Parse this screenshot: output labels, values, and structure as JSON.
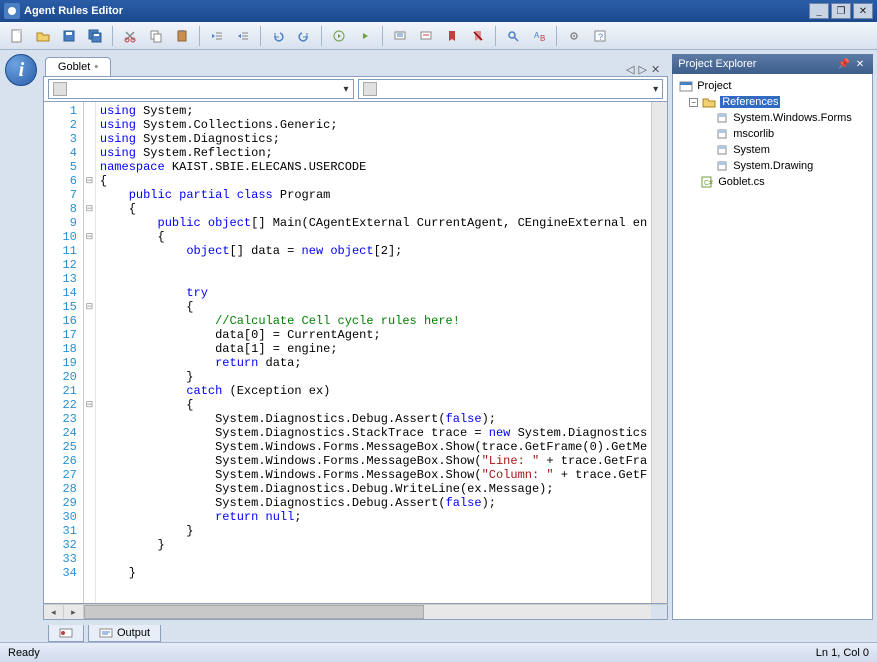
{
  "window": {
    "title": "Agent Rules Editor"
  },
  "tab": {
    "name": "Goblet"
  },
  "combos": {
    "left": "",
    "right": ""
  },
  "code": {
    "lines": [
      {
        "n": 1,
        "fold": "",
        "t": [
          {
            "c": "kw",
            "s": "using"
          },
          {
            "c": "",
            "s": " System;"
          }
        ]
      },
      {
        "n": 2,
        "fold": "",
        "t": [
          {
            "c": "kw",
            "s": "using"
          },
          {
            "c": "",
            "s": " System.Collections.Generic;"
          }
        ]
      },
      {
        "n": 3,
        "fold": "",
        "t": [
          {
            "c": "kw",
            "s": "using"
          },
          {
            "c": "",
            "s": " System.Diagnostics;"
          }
        ]
      },
      {
        "n": 4,
        "fold": "",
        "t": [
          {
            "c": "kw",
            "s": "using"
          },
          {
            "c": "",
            "s": " System.Reflection;"
          }
        ]
      },
      {
        "n": 5,
        "fold": "",
        "t": [
          {
            "c": "kw",
            "s": "namespace"
          },
          {
            "c": "",
            "s": " KAIST.SBIE.ELECANS.USERCODE"
          }
        ]
      },
      {
        "n": 6,
        "fold": "⊟",
        "t": [
          {
            "c": "",
            "s": "{"
          }
        ]
      },
      {
        "n": 7,
        "fold": "",
        "t": [
          {
            "c": "",
            "s": "    "
          },
          {
            "c": "kw",
            "s": "public partial class"
          },
          {
            "c": "",
            "s": " Program"
          }
        ]
      },
      {
        "n": 8,
        "fold": "⊟",
        "t": [
          {
            "c": "",
            "s": "    {"
          }
        ]
      },
      {
        "n": 9,
        "fold": "",
        "t": [
          {
            "c": "",
            "s": "        "
          },
          {
            "c": "kw",
            "s": "public object"
          },
          {
            "c": "",
            "s": "[] Main(CAgentExternal CurrentAgent, CEngineExternal en"
          }
        ]
      },
      {
        "n": 10,
        "fold": "⊟",
        "t": [
          {
            "c": "",
            "s": "        {"
          }
        ]
      },
      {
        "n": 11,
        "fold": "",
        "t": [
          {
            "c": "",
            "s": "            "
          },
          {
            "c": "kw",
            "s": "object"
          },
          {
            "c": "",
            "s": "[] data = "
          },
          {
            "c": "kw",
            "s": "new object"
          },
          {
            "c": "",
            "s": "["
          },
          {
            "c": "num",
            "s": "2"
          },
          {
            "c": "",
            "s": "];"
          }
        ]
      },
      {
        "n": 12,
        "fold": "",
        "t": [
          {
            "c": "",
            "s": ""
          }
        ]
      },
      {
        "n": 13,
        "fold": "",
        "t": [
          {
            "c": "",
            "s": ""
          }
        ]
      },
      {
        "n": 14,
        "fold": "",
        "t": [
          {
            "c": "",
            "s": "            "
          },
          {
            "c": "kw",
            "s": "try"
          }
        ]
      },
      {
        "n": 15,
        "fold": "⊟",
        "t": [
          {
            "c": "",
            "s": "            {"
          }
        ]
      },
      {
        "n": 16,
        "fold": "",
        "t": [
          {
            "c": "",
            "s": "                "
          },
          {
            "c": "cm",
            "s": "//Calculate Cell cycle rules here!"
          }
        ]
      },
      {
        "n": 17,
        "fold": "",
        "t": [
          {
            "c": "",
            "s": "                data["
          },
          {
            "c": "num",
            "s": "0"
          },
          {
            "c": "",
            "s": "] = CurrentAgent;"
          }
        ]
      },
      {
        "n": 18,
        "fold": "",
        "t": [
          {
            "c": "",
            "s": "                data["
          },
          {
            "c": "num",
            "s": "1"
          },
          {
            "c": "",
            "s": "] = engine;"
          }
        ]
      },
      {
        "n": 19,
        "fold": "",
        "t": [
          {
            "c": "",
            "s": "                "
          },
          {
            "c": "kw",
            "s": "return"
          },
          {
            "c": "",
            "s": " data;"
          }
        ]
      },
      {
        "n": 20,
        "fold": "",
        "t": [
          {
            "c": "",
            "s": "            }"
          }
        ]
      },
      {
        "n": 21,
        "fold": "",
        "t": [
          {
            "c": "",
            "s": "            "
          },
          {
            "c": "kw",
            "s": "catch"
          },
          {
            "c": "",
            "s": " (Exception ex)"
          }
        ]
      },
      {
        "n": 22,
        "fold": "⊟",
        "t": [
          {
            "c": "",
            "s": "            {"
          }
        ]
      },
      {
        "n": 23,
        "fold": "",
        "t": [
          {
            "c": "",
            "s": "                System.Diagnostics.Debug.Assert("
          },
          {
            "c": "kw",
            "s": "false"
          },
          {
            "c": "",
            "s": ");"
          }
        ]
      },
      {
        "n": 24,
        "fold": "",
        "t": [
          {
            "c": "",
            "s": "                System.Diagnostics.StackTrace trace = "
          },
          {
            "c": "kw",
            "s": "new"
          },
          {
            "c": "",
            "s": " System.Diagnostics"
          }
        ]
      },
      {
        "n": 25,
        "fold": "",
        "t": [
          {
            "c": "",
            "s": "                System.Windows.Forms.MessageBox.Show(trace.GetFrame("
          },
          {
            "c": "num",
            "s": "0"
          },
          {
            "c": "",
            "s": ").GetMe"
          }
        ]
      },
      {
        "n": 26,
        "fold": "",
        "t": [
          {
            "c": "",
            "s": "                System.Windows.Forms.MessageBox.Show("
          },
          {
            "c": "str",
            "s": "\"Line: \""
          },
          {
            "c": "",
            "s": " + trace.GetFra"
          }
        ]
      },
      {
        "n": 27,
        "fold": "",
        "t": [
          {
            "c": "",
            "s": "                System.Windows.Forms.MessageBox.Show("
          },
          {
            "c": "str",
            "s": "\"Column: \""
          },
          {
            "c": "",
            "s": " + trace.GetF"
          }
        ]
      },
      {
        "n": 28,
        "fold": "",
        "t": [
          {
            "c": "",
            "s": "                System.Diagnostics.Debug.WriteLine(ex.Message);"
          }
        ]
      },
      {
        "n": 29,
        "fold": "",
        "t": [
          {
            "c": "",
            "s": "                System.Diagnostics.Debug.Assert("
          },
          {
            "c": "kw",
            "s": "false"
          },
          {
            "c": "",
            "s": ");"
          }
        ]
      },
      {
        "n": 30,
        "fold": "",
        "t": [
          {
            "c": "",
            "s": "                "
          },
          {
            "c": "kw",
            "s": "return null"
          },
          {
            "c": "",
            "s": ";"
          }
        ]
      },
      {
        "n": 31,
        "fold": "",
        "t": [
          {
            "c": "",
            "s": "            }"
          }
        ]
      },
      {
        "n": 32,
        "fold": "",
        "t": [
          {
            "c": "",
            "s": "        }"
          }
        ]
      },
      {
        "n": 33,
        "fold": "",
        "t": [
          {
            "c": "",
            "s": ""
          }
        ]
      },
      {
        "n": 34,
        "fold": "",
        "t": [
          {
            "c": "",
            "s": "    }"
          }
        ]
      }
    ]
  },
  "explorer": {
    "title": "Project Explorer",
    "root": "Project",
    "references_label": "References",
    "refs": [
      "System.Windows.Forms",
      "mscorlib",
      "System",
      "System.Drawing"
    ],
    "file": "Goblet.cs"
  },
  "bottom": {
    "output_tab": "Output"
  },
  "status": {
    "left": "Ready",
    "right": "Ln 1, Col 0"
  }
}
